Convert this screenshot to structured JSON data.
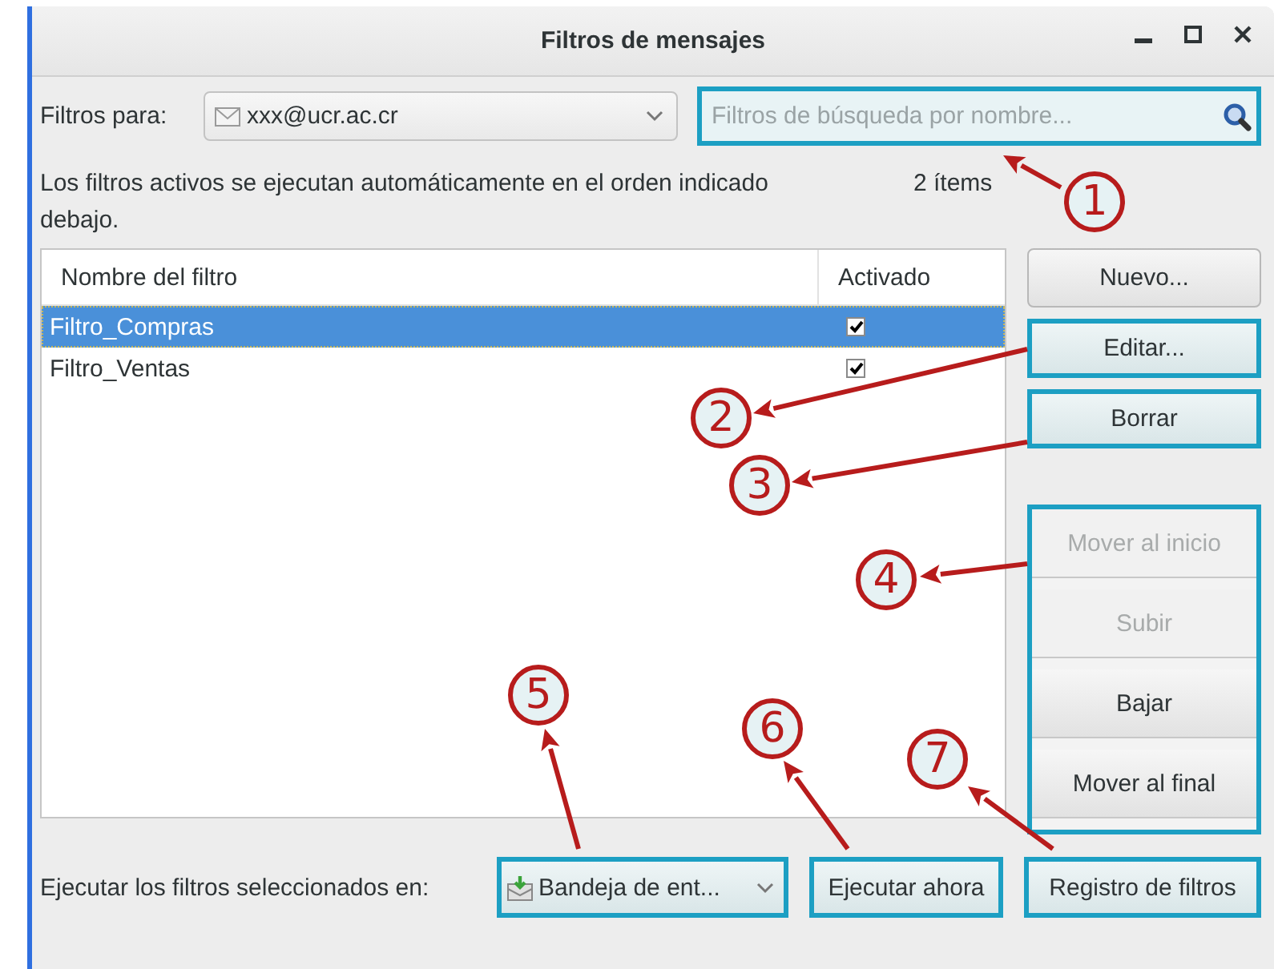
{
  "window": {
    "title": "Filtros de mensajes"
  },
  "account": {
    "label": "Filtros para:",
    "value": "xxx@ucr.ac.cr"
  },
  "search": {
    "placeholder": "Filtros de búsqueda por nombre...",
    "highlighted": true
  },
  "description": "Los filtros activos se ejecutan automáticamente en el orden indicado debajo.",
  "count": "2 ítems",
  "filter_list": {
    "columns": [
      "Nombre del filtro",
      "Activado"
    ],
    "rows": [
      {
        "name": "Filtro_Compras",
        "checked": true,
        "selected": true
      },
      {
        "name": "Filtro_Ventas",
        "checked": true,
        "selected": false
      }
    ]
  },
  "side_buttons": [
    {
      "label": "Nuevo...",
      "highlighted": false
    },
    {
      "label": "Editar...",
      "highlighted": true
    },
    {
      "label": "Borrar",
      "highlighted": true
    }
  ],
  "move_buttons": {
    "highlighted": true,
    "items": [
      {
        "label": "Mover al inicio",
        "disabled": true
      },
      {
        "label": "Subir",
        "disabled": true
      },
      {
        "label": "Bajar",
        "disabled": false
      },
      {
        "label": "Mover al final",
        "disabled": false
      }
    ]
  },
  "run_in": {
    "label": "Ejecutar los filtros seleccionados en:",
    "folder": "Bandeja de ent...",
    "highlighted": true
  },
  "bottom_buttons": [
    {
      "label": "Ejecutar ahora",
      "highlighted": true
    },
    {
      "label": "Registro de filtros",
      "highlighted": true
    }
  ],
  "callouts": [
    {
      "number": "1"
    },
    {
      "number": "2"
    },
    {
      "number": "3"
    },
    {
      "number": "4"
    },
    {
      "number": "5"
    },
    {
      "number": "6"
    },
    {
      "number": "7"
    }
  ]
}
